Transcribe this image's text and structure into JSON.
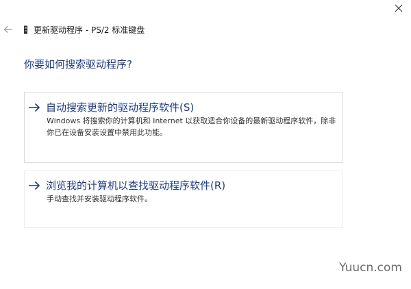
{
  "window": {
    "title": "更新驱动程序 - PS/2 标准键盘"
  },
  "icons": {
    "close": "close-icon",
    "back": "back-arrow-icon",
    "device": "keyboard-device-icon",
    "option_arrow": "arrow-right-icon"
  },
  "main": {
    "heading": "你要如何搜索驱动程序?",
    "options": [
      {
        "title": "自动搜索更新的驱动程序软件(S)",
        "description": "Windows 将搜索你的计算机和 Internet 以获取适合你设备的最新驱动程序软件，除非你已在设备安装设置中禁用此功能。"
      },
      {
        "title": "浏览我的计算机以查找驱动程序软件(R)",
        "description": "手动查找并安装驱动程序软件。"
      }
    ]
  },
  "watermark": "Yuucn.com",
  "colors": {
    "link_blue": "#1d3a8a",
    "border": "#d9d9d9",
    "background": "#ffffff"
  }
}
